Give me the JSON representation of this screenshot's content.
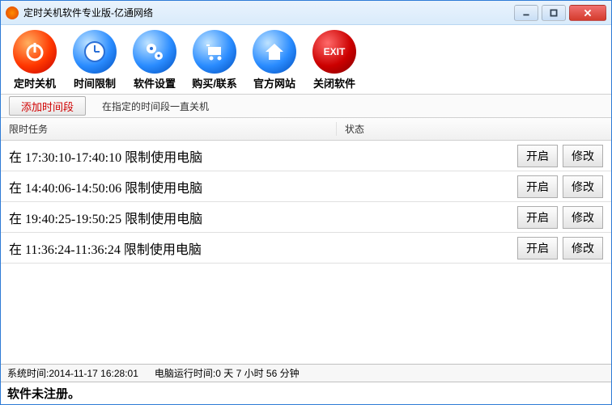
{
  "title": "定时关机软件专业版-亿通网络",
  "toolbar": [
    {
      "label": "定时关机",
      "icon": "power"
    },
    {
      "label": "时间限制",
      "icon": "clock"
    },
    {
      "label": "软件设置",
      "icon": "gears"
    },
    {
      "label": "购买/联系",
      "icon": "cart"
    },
    {
      "label": "官方网站",
      "icon": "home"
    },
    {
      "label": "关闭软件",
      "icon": "exit"
    }
  ],
  "subbar": {
    "add_label": "添加时间段",
    "hint": "在指定的时间段一直关机"
  },
  "columns": {
    "task": "限时任务",
    "status": "状态"
  },
  "row_buttons": {
    "start": "开启",
    "edit": "修改"
  },
  "rows": [
    {
      "text": "在 17:30:10-17:40:10 限制使用电脑"
    },
    {
      "text": "在 14:40:06-14:50:06 限制使用电脑"
    },
    {
      "text": "在 19:40:25-19:50:25 限制使用电脑"
    },
    {
      "text": "在 11:36:24-11:36:24 限制使用电脑"
    }
  ],
  "status": {
    "systime_label": "系统时间:",
    "systime_value": "2014-11-17 16:28:01",
    "uptime_label": "电脑运行时间:",
    "uptime_value": "0 天 7 小时 56 分钟"
  },
  "footer": "软件未注册。"
}
